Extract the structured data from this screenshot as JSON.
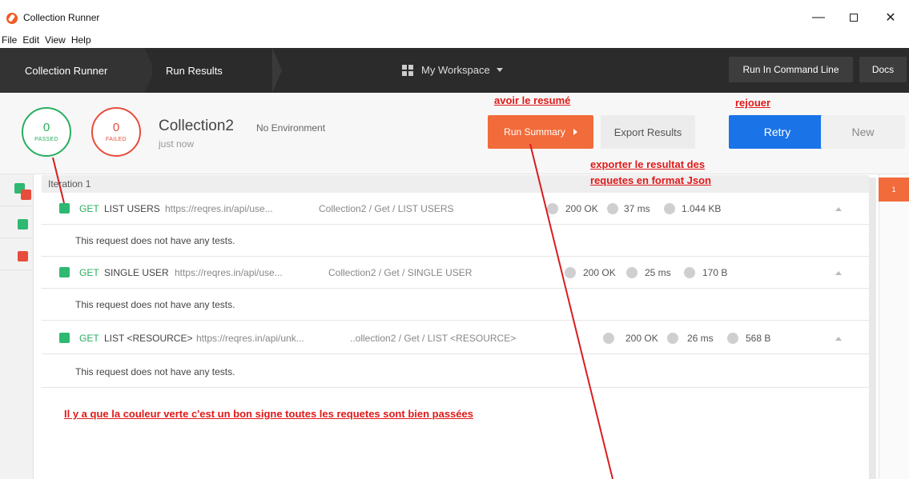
{
  "window": {
    "title": "Collection Runner",
    "minimize_glyph": "—",
    "close_glyph": "✕"
  },
  "menu": [
    "File",
    "Edit",
    "View",
    "Help"
  ],
  "nav": {
    "tab_runner": "Collection Runner",
    "tab_results": "Run Results",
    "workspace": "My Workspace",
    "run_cmd": "Run In Command Line",
    "docs": "Docs"
  },
  "summary": {
    "passed_count": "0",
    "passed_label": "PASSED",
    "failed_count": "0",
    "failed_label": "FAILED",
    "collection_name": "Collection2",
    "environment": "No Environment",
    "time": "just now"
  },
  "actions": {
    "run_summary": "Run Summary",
    "export": "Export Results",
    "retry": "Retry",
    "new": "New"
  },
  "annotations": {
    "resume": "avoir le resumé",
    "rejouer": "rejouer",
    "export_line1": "exporter le resultat des",
    "export_line2": "requetes en format Json",
    "green_note": "Il y a que la couleur verte c'est un bon signe toutes les requetes sont bien passées"
  },
  "iteration_label": "Iteration 1",
  "requests": [
    {
      "method": "GET",
      "name": "LIST USERS",
      "url": "https://reqres.in/api/use...",
      "path": "Collection2 / Get / LIST USERS",
      "status": "200 OK",
      "time": "37 ms",
      "size": "1.044 KB",
      "test_msg": "This request does not have any tests."
    },
    {
      "method": "GET",
      "name": "SINGLE USER",
      "url": "https://reqres.in/api/use...",
      "path": "Collection2 / Get / SINGLE USER",
      "status": "200 OK",
      "time": "25 ms",
      "size": "170 B",
      "test_msg": "This request does not have any tests."
    },
    {
      "method": "GET",
      "name": "LIST <RESOURCE>",
      "url": "https://reqres.in/api/unk...",
      "path": "..ollection2 / Get / LIST <RESOURCE>",
      "status": "200 OK",
      "time": "26 ms",
      "size": "568 B",
      "test_msg": "This request does not have any tests."
    }
  ],
  "right_badge": "1",
  "colors": {
    "accent_orange": "#f26b3a",
    "retry_blue": "#1b73e8",
    "pass_green": "#27ae60",
    "fail_red": "#e74c3c",
    "annotation_red": "#e01919",
    "nav_dark": "#2b2b2b"
  }
}
